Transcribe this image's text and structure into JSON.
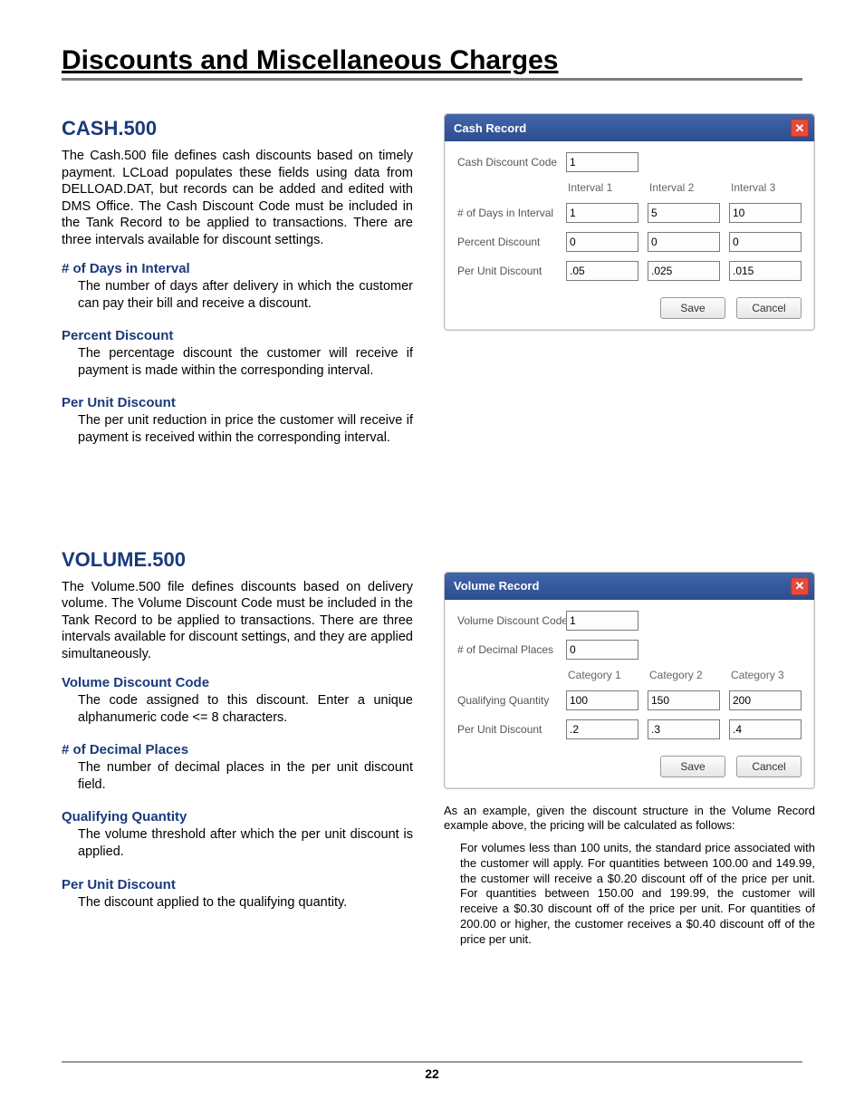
{
  "page": {
    "title": "Discounts and Miscellaneous Charges",
    "number": "22"
  },
  "cash": {
    "heading": "CASH.500",
    "intro": "The Cash.500 file defines cash discounts based on timely payment. LCLoad populates these fields using data from DELLOAD.DAT, but records can be added and edited with DMS Office. The Cash Discount Code must be included in the Tank Record to be applied to transactions. There are three intervals available for discount settings.",
    "fields": [
      {
        "title": "# of Days in Interval",
        "desc": "The number of days after delivery in which the customer can pay their bill and receive a discount."
      },
      {
        "title": "Percent Discount",
        "desc": "The percentage discount the customer will receive if payment is made within the corresponding interval."
      },
      {
        "title": "Per Unit Discount",
        "desc": "The per unit reduction in price the customer will receive if payment is received within the corresponding interval."
      }
    ],
    "dialog": {
      "title": "Cash Record",
      "rows": {
        "code_label": "Cash Discount Code",
        "code_value": "1",
        "col_labels": [
          "Interval 1",
          "Interval 2",
          "Interval 3"
        ],
        "days_label": "# of Days in Interval",
        "days": [
          "1",
          "5",
          "10"
        ],
        "percent_label": "Percent Discount",
        "percent": [
          "0",
          "0",
          "0"
        ],
        "perunit_label": "Per Unit Discount",
        "perunit": [
          ".05",
          ".025",
          ".015"
        ]
      },
      "save": "Save",
      "cancel": "Cancel"
    }
  },
  "volume": {
    "heading": "VOLUME.500",
    "intro": "The Volume.500 file defines discounts based on delivery volume. The Volume Discount Code must be included in the Tank Record to be applied to transactions. There are three intervals available for discount settings, and they are applied simultaneously.",
    "fields": [
      {
        "title": "Volume Discount Code",
        "desc": "The code assigned to this discount. Enter a unique alphanumeric code <= 8 characters."
      },
      {
        "title": "# of Decimal Places",
        "desc": "The number of decimal places in the per unit discount field."
      },
      {
        "title": "Qualifying Quantity",
        "desc": "The volume threshold after which the per unit discount is applied."
      },
      {
        "title": "Per Unit Discount",
        "desc": "The discount applied to the qualifying quantity."
      }
    ],
    "dialog": {
      "title": "Volume Record",
      "rows": {
        "code_label": "Volume Discount Code",
        "code_value": "1",
        "dec_label": "# of Decimal Places",
        "dec_value": "0",
        "col_labels": [
          "Category 1",
          "Category 2",
          "Category 3"
        ],
        "qty_label": "Qualifying Quantity",
        "qty": [
          "100",
          "150",
          "200"
        ],
        "perunit_label": "Per Unit Discount",
        "perunit": [
          ".2",
          ".3",
          ".4"
        ]
      },
      "save": "Save",
      "cancel": "Cancel"
    },
    "example_intro": "As an example, given the discount structure in the Volume Record example above, the pricing will be calculated as follows:",
    "example_body": "For volumes less than 100 units, the standard price associated with the customer will apply. For quantities between 100.00 and 149.99, the customer will receive a $0.20 discount off of the price per unit. For quantities between 150.00 and 199.99, the customer will receive a $0.30 discount off of the price per unit. For quantities of 200.00 or higher, the customer receives a $0.40 discount off of the price per unit."
  }
}
